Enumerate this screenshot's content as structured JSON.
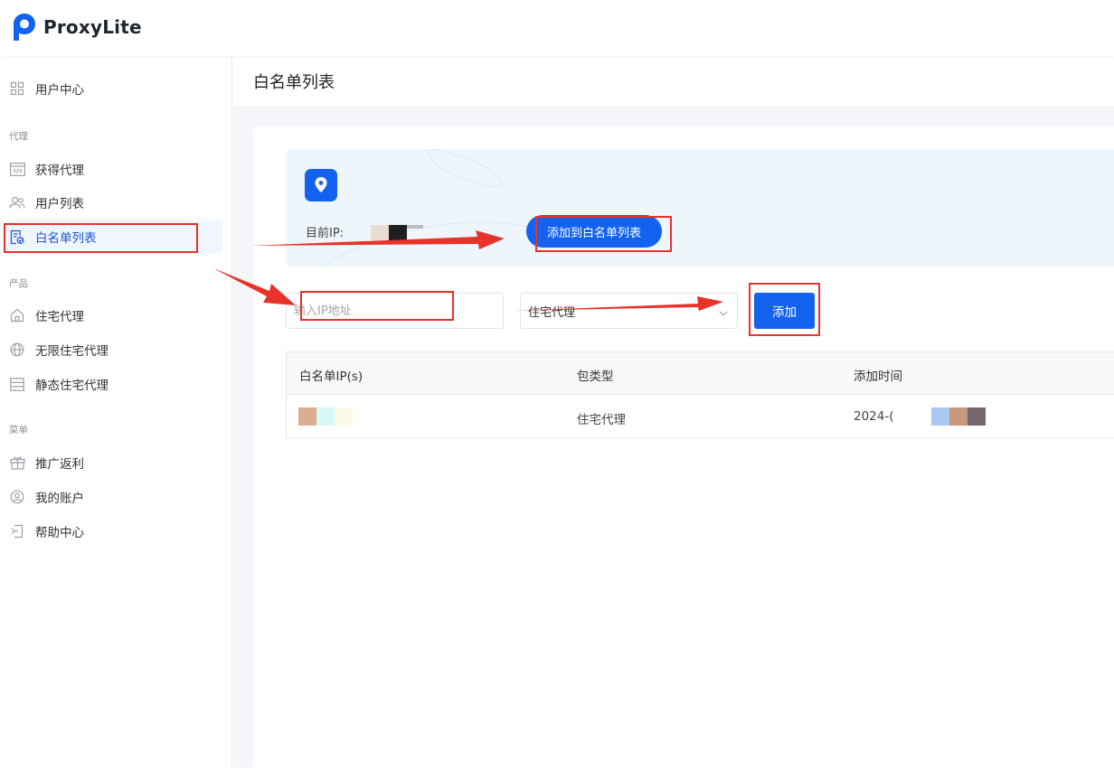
{
  "app": {
    "name": "ProxyLite",
    "brand_color": "#1463f0",
    "annotation_color": "#e8322a"
  },
  "sidebar": {
    "user_center": {
      "label": "用户中心",
      "icon": "grid-icon"
    },
    "sections": [
      {
        "label": "代理",
        "items": [
          {
            "label": "获得代理",
            "icon": "code-window-icon"
          },
          {
            "label": "用户列表",
            "icon": "users-icon"
          },
          {
            "label": "白名单列表",
            "icon": "whitelist-doc-icon",
            "active": true
          }
        ]
      },
      {
        "label": "产品",
        "items": [
          {
            "label": "住宅代理",
            "icon": "house-icon"
          },
          {
            "label": "无限住宅代理",
            "icon": "globe-icon"
          },
          {
            "label": "静态住宅代理",
            "icon": "server-icon"
          }
        ]
      },
      {
        "label": "菜单",
        "items": [
          {
            "label": "推广返利",
            "icon": "gift-icon"
          },
          {
            "label": "我的账户",
            "icon": "account-icon"
          },
          {
            "label": "帮助中心",
            "icon": "help-icon"
          }
        ]
      }
    ]
  },
  "page": {
    "title": "白名单列表"
  },
  "ip_banner": {
    "current_ip_label": "目前IP:",
    "add_button": "添加到白名单列表"
  },
  "form": {
    "ip_placeholder": "输入IP地址",
    "type_selected": "住宅代理",
    "add_button": "添加"
  },
  "table": {
    "columns": [
      "白名单IP(s)",
      "包类型",
      "添加时间"
    ],
    "rows": [
      {
        "ip": "",
        "type": "住宅代理",
        "added": "2024-("
      }
    ]
  }
}
